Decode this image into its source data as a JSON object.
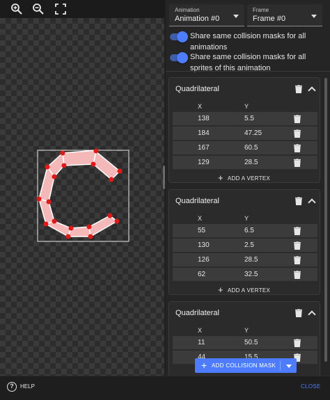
{
  "toolbar": {
    "icons": [
      "zoom-in-icon",
      "zoom-out-icon",
      "fit-screen-icon"
    ]
  },
  "selectors": {
    "animation": {
      "label": "Animation",
      "value": "Animation #0"
    },
    "frame": {
      "label": "Frame",
      "value": "Frame #0"
    }
  },
  "toggles": {
    "all_animations": {
      "text": "Share same collision masks for all animations",
      "checked": true
    },
    "all_sprites": {
      "text": "Share same collision masks for all sprites of this animation",
      "checked": true
    }
  },
  "masks": {
    "col_x": "X",
    "col_y": "Y",
    "add_vertex": "ADD A VERTEX",
    "items": [
      {
        "title": "Quadrilateral",
        "rows": [
          {
            "x": "138",
            "y": "5.5"
          },
          {
            "x": "184",
            "y": "47.25"
          },
          {
            "x": "167",
            "y": "60.5"
          },
          {
            "x": "129",
            "y": "28.5"
          }
        ]
      },
      {
        "title": "Quadrilateral",
        "rows": [
          {
            "x": "55",
            "y": "6.5"
          },
          {
            "x": "130",
            "y": "2.5"
          },
          {
            "x": "126",
            "y": "28.5"
          },
          {
            "x": "62",
            "y": "32.5"
          }
        ]
      },
      {
        "title": "Quadrilateral",
        "rows": [
          {
            "x": "11",
            "y": "50.5"
          },
          {
            "x": "44",
            "y": "15.5"
          }
        ]
      }
    ]
  },
  "add_mask_button": "ADD COLLISION MASK",
  "footer": {
    "help": "HELP",
    "close": "CLOSE"
  },
  "colors": {
    "accent": "#4d7cff",
    "vertex": "#e01818",
    "mask_fill": "#f4b8b8"
  }
}
